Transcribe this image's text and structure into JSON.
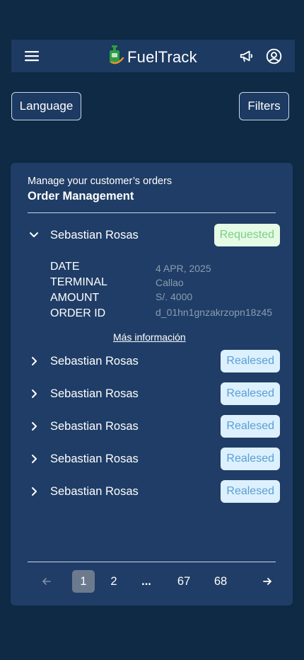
{
  "header": {
    "app_title": "FuelTrack",
    "icons": [
      "menu-icon",
      "fuel-logo-icon",
      "megaphone-icon",
      "user-icon"
    ]
  },
  "toolbar": {
    "language_label": "Language",
    "filters_label": "Filters"
  },
  "orders_card": {
    "subtitle": "Manage your customer’s orders",
    "title": "Order Management",
    "orders": [
      {
        "customer": "Sebastian Rosas",
        "status": "Requested",
        "expanded": true,
        "details": [
          {
            "label": "DATE",
            "value": "4 APR, 2025"
          },
          {
            "label": "TERMINAL",
            "value": "Callao"
          },
          {
            "label": "AMOUNT",
            "value": "S/. 4000"
          },
          {
            "label": "ORDER ID",
            "value": "d_01hn1gnzakrzopn18z45"
          }
        ],
        "more_label": "Más información"
      },
      {
        "customer": "Sebastian Rosas",
        "status": "Realesed",
        "expanded": false
      },
      {
        "customer": "Sebastian Rosas",
        "status": "Realesed",
        "expanded": false
      },
      {
        "customer": "Sebastian Rosas",
        "status": "Realesed",
        "expanded": false
      },
      {
        "customer": "Sebastian Rosas",
        "status": "Realesed",
        "expanded": false
      },
      {
        "customer": "Sebastian Rosas",
        "status": "Realesed",
        "expanded": false
      }
    ]
  },
  "pagination": {
    "pages": [
      "1",
      "2",
      "...",
      "67",
      "68"
    ],
    "current": "1"
  },
  "colors": {
    "background": "#0e2a44",
    "surface": "#1f3d66",
    "requested_bg": "#e5fbe6",
    "requested_text": "#7ccf84",
    "released_bg": "#dcf0fd",
    "released_text": "#5a9ed6"
  }
}
